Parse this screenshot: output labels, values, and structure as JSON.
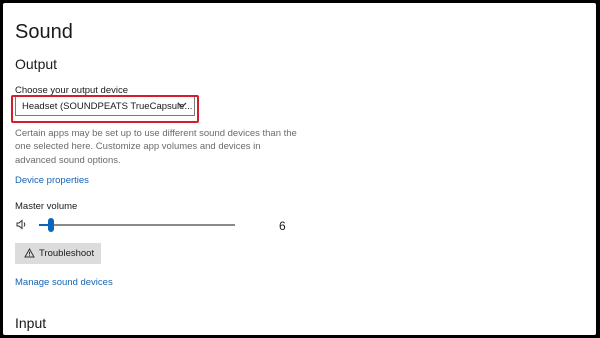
{
  "page": {
    "title": "Sound"
  },
  "output": {
    "heading": "Output",
    "device_label": "Choose your output device",
    "device_selected": "Headset (SOUNDPEATS TrueCapsule...",
    "description": "Certain apps may be set up to use different sound devices than the one selected here. Customize app volumes and devices in advanced sound options.",
    "device_properties_link": "Device properties",
    "master_volume_label": "Master volume",
    "master_volume_value": "6",
    "master_volume_level": 0.06,
    "troubleshoot_label": "Troubleshoot",
    "manage_devices_link": "Manage sound devices"
  },
  "input": {
    "heading": "Input"
  },
  "colors": {
    "accent": "#0a66b8",
    "link": "#1464b4",
    "highlight_border": "#d21f2b",
    "button_bg": "#dcdcdc"
  },
  "icons": {
    "dropdown": "chevron-down-icon",
    "volume": "speaker-icon",
    "troubleshoot": "warning-icon"
  }
}
